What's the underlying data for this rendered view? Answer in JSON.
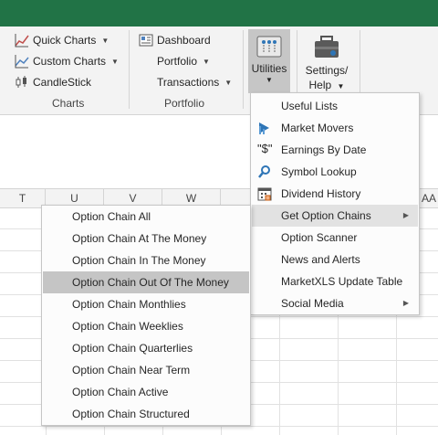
{
  "ribbon": {
    "charts": {
      "quick_charts": "Quick Charts",
      "custom_charts": "Custom Charts",
      "candlestick": "CandleStick",
      "group_label": "Charts"
    },
    "portfolio": {
      "dashboard": "Dashboard",
      "portfolio": "Portfolio",
      "transactions": "Transactions",
      "group_label": "Portfolio"
    },
    "utilities": {
      "label": "Utilities"
    },
    "settings": {
      "line1": "Settings/",
      "line2": "Help"
    }
  },
  "columns": [
    "T",
    "U",
    "V",
    "W",
    "AA"
  ],
  "utilities_menu": [
    {
      "label": "Useful Lists",
      "icon": "none"
    },
    {
      "label": "Market Movers",
      "icon": "market-movers-icon"
    },
    {
      "label": "Earnings By Date",
      "icon": "dollar-quote-icon"
    },
    {
      "label": "Symbol Lookup",
      "icon": "magnifier-icon"
    },
    {
      "label": "Dividend History",
      "icon": "calendar-icon"
    },
    {
      "label": "Get Option Chains",
      "icon": "none",
      "submenu": true
    },
    {
      "label": "Option Scanner",
      "icon": "none"
    },
    {
      "label": "News and Alerts",
      "icon": "none"
    },
    {
      "label": "MarketXLS Update Table",
      "icon": "none"
    },
    {
      "label": "Social Media",
      "icon": "none",
      "submenu": true
    }
  ],
  "option_chain_menu": [
    "Option Chain All",
    "Option Chain At The Money",
    "Option Chain In The Money",
    "Option Chain Out Of The Money",
    "Option Chain Monthlies",
    "Option Chain Weeklies",
    "Option Chain Quarterlies",
    "Option Chain Near Term",
    "Option Chain Active",
    "Option Chain Structured"
  ],
  "menu_state": {
    "highlighted_item": "Get Option Chains",
    "selected_subitem": "Option Chain Out Of The Money"
  },
  "colors": {
    "title_bar": "#217346",
    "ribbon_bg": "#f3f3f3",
    "menu_highlight": "#e2e2e2",
    "submenu_selected": "#c5c5c5"
  }
}
